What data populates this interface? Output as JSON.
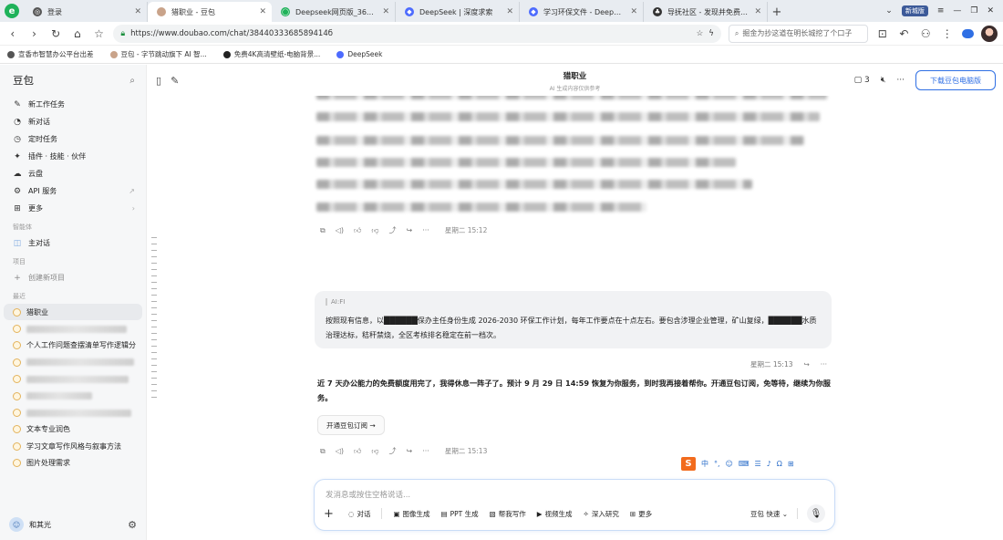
{
  "browser": {
    "tabs": [
      {
        "title": "登录"
      },
      {
        "title": "猎职业 - 豆包"
      },
      {
        "title": "Deepseek网页版_360搜索"
      },
      {
        "title": "DeepSeek | 深度求索"
      },
      {
        "title": "学习环保文件 - DeepSeek"
      },
      {
        "title": "导抚社区 - 发现并免费下载..."
      }
    ],
    "profile_badge": "新城版",
    "url": "https://www.doubao.com/chat/3844033368589414б",
    "search_placeholder": "掘金为抄这道在明长城挖了个口子"
  },
  "bookmarks": [
    {
      "label": "宣香市智慧办公平台出差"
    },
    {
      "label": "豆包 - 字节跳动旗下 AI 智..."
    },
    {
      "label": "免费4K高清壁纸-电脑背景..."
    },
    {
      "label": "DeepSeek"
    }
  ],
  "sidebar": {
    "brand": "豆包",
    "menu": [
      {
        "label": "新工作任务",
        "icon": "edit-icon"
      },
      {
        "label": "新对话",
        "icon": "chat-icon"
      },
      {
        "label": "定时任务",
        "icon": "clock-icon"
      },
      {
        "label": "插件 · 技能 · 伙伴",
        "icon": "plugin-icon"
      },
      {
        "label": "云盘",
        "icon": "cloud-icon"
      },
      {
        "label": "API 服务",
        "icon": "api-icon"
      },
      {
        "label": "更多",
        "icon": "grid-icon"
      }
    ],
    "section_personal": "智能体",
    "main_chat": "主对话",
    "section_projects": "项目",
    "new_project": "创建新项目",
    "section_recent": "最近",
    "recent": [
      "猎职业",
      "",
      "个人工作问题查摆清单写作逻辑分",
      "",
      "",
      "",
      "",
      "文本专业润色",
      "学习文章写作风格与叙事方法",
      "图片处理需求"
    ],
    "user_name": "和其光"
  },
  "topbar": {
    "title": "猎职业",
    "subtitle": "AI 生成内容仅供参考",
    "share_count": "3",
    "download_button": "下载豆包电脑版"
  },
  "conversation": {
    "bot_time_1": "星期二 15:12",
    "user_tag": "AI:FI",
    "user_message": "按照现有信息，以██████保办主任身份生成 2026-2030 环保工作计划，每年工作要点在十点左右。要包含涉理企业管理，矿山复绿，██████水质治理达标，秸秆禁烧，全区考核排名稳定在前一档次。",
    "user_time": "星期二 15:13",
    "bot_reply": "近 7 天办公能力的免费额度用完了，我得休息一阵子了。预计 9 月 29 日 14:59 恢复为你服务，到时我再接着帮你。开通豆包订阅，免等待，继续为你服务。",
    "subscribe_button": "开通豆包订阅 →",
    "bot_time_2": "星期二 15:13"
  },
  "ime_bar": [
    "中",
    "°,",
    "☺",
    "⌨",
    "☰",
    "♪",
    "Ω",
    "⊞"
  ],
  "composer": {
    "placeholder": "发消息或按住空格说话...",
    "tools": [
      "对话",
      "图像生成",
      "PPT 生成",
      "帮我写作",
      "视频生成",
      "深入研究",
      "更多"
    ],
    "model": "豆包 快速"
  }
}
